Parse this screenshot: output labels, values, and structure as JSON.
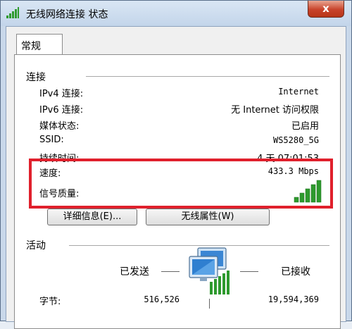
{
  "window": {
    "title": "无线网络连接 状态",
    "close_label": "x"
  },
  "tabs": [
    {
      "label": "常规"
    }
  ],
  "connection": {
    "group_label": "连接",
    "rows": [
      {
        "label": "IPv4 连接:",
        "value": "Internet"
      },
      {
        "label": "IPv6 连接:",
        "value": "无 Internet 访问权限"
      },
      {
        "label": "媒体状态:",
        "value": "已启用"
      },
      {
        "label": "SSID:",
        "value": "WS5280_5G"
      },
      {
        "label": "持续时间:",
        "value": "4 天 07:01:53"
      },
      {
        "label": "速度:",
        "value": "433.3 Mbps"
      },
      {
        "label": "信号质量:",
        "signal_bars": 5,
        "signal_max": 5
      }
    ]
  },
  "buttons": {
    "details": "详细信息(E)...",
    "wireless_props": "无线属性(W)"
  },
  "activity": {
    "group_label": "活动",
    "sent_label": "已发送",
    "received_label": "已接收",
    "bytes_label": "字节:",
    "bytes_sent": "516,526",
    "bytes_received": "19,594,369"
  },
  "colors": {
    "highlight": "#e0202c",
    "signal": "#2e9a2e"
  },
  "icons": {
    "title": "signal-bars-icon",
    "network": "network-computers-icon"
  }
}
